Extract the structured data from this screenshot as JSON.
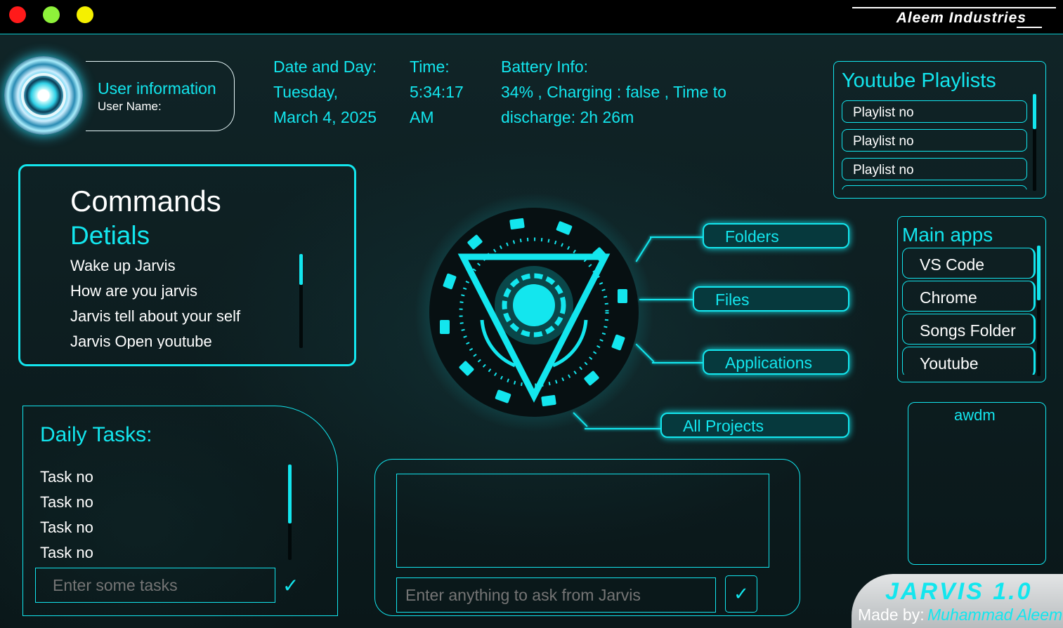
{
  "window": {
    "brand": "Aleem Industries",
    "controls": {
      "close": "#ff1a1a",
      "minimize": "#8ef23a",
      "maximize": "#f5f000"
    }
  },
  "user": {
    "title": "User information",
    "name_label": "User Name:"
  },
  "date": {
    "label": "Date and Day:",
    "day": "Tuesday,",
    "date": "March 4, 2025"
  },
  "time": {
    "label": "Time:",
    "value": "5:34:17",
    "ampm": "AM"
  },
  "battery": {
    "label": "Battery Info:",
    "line1": "34% , Charging : false , Time to",
    "line2": "discharge: 2h 26m"
  },
  "commands": {
    "title": "Commands",
    "subtitle": "Detials",
    "items": [
      "Wake up Jarvis",
      "How are you jarvis",
      "Jarvis tell about your self",
      "Jarvis Open youtube"
    ]
  },
  "tasks": {
    "title": "Daily Tasks:",
    "items": [
      "Task no",
      "Task no",
      "Task no",
      "Task no"
    ],
    "input_placeholder": "Enter some tasks",
    "submit": "✓"
  },
  "center_buttons": {
    "folders": "Folders",
    "files": "Files",
    "applications": "Applications",
    "all_projects": "All Projects"
  },
  "ask": {
    "input_placeholder": "Enter anything to ask from Jarvis",
    "submit": "✓"
  },
  "playlists": {
    "title": "Youtube Playlists",
    "items": [
      "Playlist no",
      "Playlist no",
      "Playlist no"
    ]
  },
  "main_apps": {
    "title": "Main apps",
    "items": [
      "VS Code",
      "Chrome",
      "Songs Folder",
      "Youtube"
    ]
  },
  "side_box": {
    "title": "awdm"
  },
  "footer": {
    "product": "JARVIS 1.0",
    "made_by_label": "Made by:",
    "author": "Muhammad Aleem"
  },
  "theme": {
    "accent": "#13e6ee",
    "background": "#0b1a1c"
  }
}
